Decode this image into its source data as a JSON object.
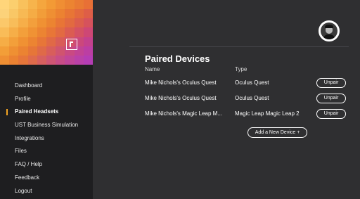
{
  "theme": {
    "accent": "#f5a623",
    "sidebar_bg": "#1e1e20",
    "main_bg": "#2f2f31",
    "mosaic_colors": [
      "#ffd57a",
      "#fbcf6e",
      "#f9c15c",
      "#f7b44c",
      "#f5a63e",
      "#f39a35",
      "#f08e33",
      "#ec8431",
      "#e97a33",
      "#e87036",
      "#fcd27a",
      "#f9c766",
      "#f7b954",
      "#f5ac45",
      "#f29d39",
      "#ef8f33",
      "#ec8231",
      "#e87535",
      "#e3693d",
      "#de5e47",
      "#fbc86a",
      "#f8bd5a",
      "#f6ae49",
      "#f39f3c",
      "#f09133",
      "#ec8431",
      "#e87536",
      "#e26a40",
      "#dc5d4d",
      "#d6525c",
      "#f9bc58",
      "#f6ae48",
      "#f39f3b",
      "#f09234",
      "#ec8432",
      "#e87637",
      "#e26a42",
      "#db5c52",
      "#d45164",
      "#ce4775",
      "#f6ad46",
      "#f39f3a",
      "#f09133",
      "#ec8432",
      "#e77638",
      "#e06946",
      "#d95d57",
      "#d2526a",
      "#cb487c",
      "#c4418d",
      "#f39e38",
      "#ef9033",
      "#eb8332",
      "#e67638",
      "#df6a48",
      "#d85e5b",
      "#d0546f",
      "#c94a82",
      "#c24394",
      "#bc3ea3",
      "#ef8f33",
      "#eb8232",
      "#e6763a",
      "#df6b4b",
      "#d7605f",
      "#cf5674",
      "#c84d87",
      "#c14699",
      "#ba41a8",
      "#b53db4"
    ]
  },
  "sidebar": {
    "items": [
      {
        "label": "Dashboard",
        "active": false
      },
      {
        "label": "Profile",
        "active": false
      },
      {
        "label": "Paired Headsets",
        "active": true
      },
      {
        "label": "UST Business Simulation",
        "active": false
      },
      {
        "label": "Integrations",
        "active": false
      },
      {
        "label": "Files",
        "active": false
      },
      {
        "label": "FAQ / Help",
        "active": false
      },
      {
        "label": "Feedback",
        "active": false
      },
      {
        "label": "Logout",
        "active": false
      }
    ]
  },
  "main": {
    "title": "Paired Devices",
    "columns": {
      "name": "Name",
      "type": "Type"
    },
    "devices": [
      {
        "name": "Mike Nichols's Oculus Quest",
        "type": "Oculus Quest",
        "action": "Unpair"
      },
      {
        "name": "Mike Nichols's Oculus Quest",
        "type": "Oculus Quest",
        "action": "Unpair"
      },
      {
        "name": "Mike Nichols's Magic Leap M...",
        "type": "Magic Leap Magic Leap 2",
        "action": "Unpair"
      }
    ],
    "add_button": "Add a New Device +"
  },
  "user": {
    "avatar_icon": "user-avatar-icon"
  }
}
